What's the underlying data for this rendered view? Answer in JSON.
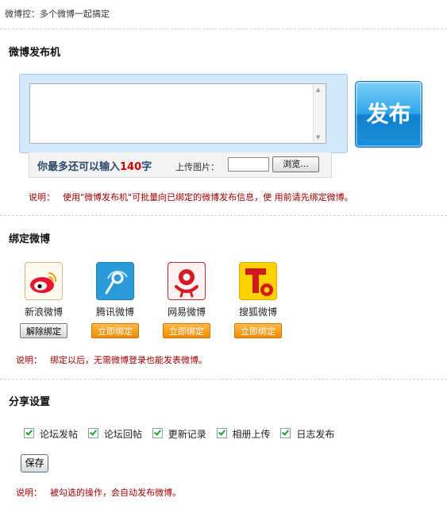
{
  "breadcrumb": "微博控：多个微博一起搞定",
  "composer": {
    "title": "微博发布机",
    "remain_prefix": "你最多还可以输入",
    "remain_count": "140",
    "remain_suffix": "字",
    "upload_label": "上传图片：",
    "browse_label": "浏览...",
    "publish_label": "发布",
    "note_prefix": "说明：",
    "note": "使用\"微博发布机\"可批量向已绑定的微博发布信息，使 用前请先绑定微博。"
  },
  "binding": {
    "title": "绑定微博",
    "platforms": [
      {
        "name": "新浪微博",
        "icon": "sina-weibo-icon",
        "action": "解除绑定",
        "bound": true
      },
      {
        "name": "腾讯微博",
        "icon": "tencent-weibo-icon",
        "action": "立即绑定",
        "bound": false
      },
      {
        "name": "网易微博",
        "icon": "netease-weibo-icon",
        "action": "立即绑定",
        "bound": false
      },
      {
        "name": "搜狐微博",
        "icon": "sohu-weibo-icon",
        "action": "立即绑定",
        "bound": false
      }
    ],
    "note_prefix": "说明：",
    "note": "绑定以后，无需微博登录也能发表微博。"
  },
  "share": {
    "title": "分享设置",
    "options": [
      {
        "label": "论坛发帖",
        "checked": true
      },
      {
        "label": "论坛回帖",
        "checked": true
      },
      {
        "label": "更新记录",
        "checked": true
      },
      {
        "label": "相册上传",
        "checked": true
      },
      {
        "label": "日志发布",
        "checked": true
      }
    ],
    "save_label": "保存",
    "note_prefix": "说明：",
    "note": "被勾选的操作，会自动发布微博。"
  },
  "colors": {
    "note_red": "#a00000",
    "count_red": "#d40000",
    "bind_orange": "#f08a00",
    "publish_blue": "#1b8fdc"
  }
}
